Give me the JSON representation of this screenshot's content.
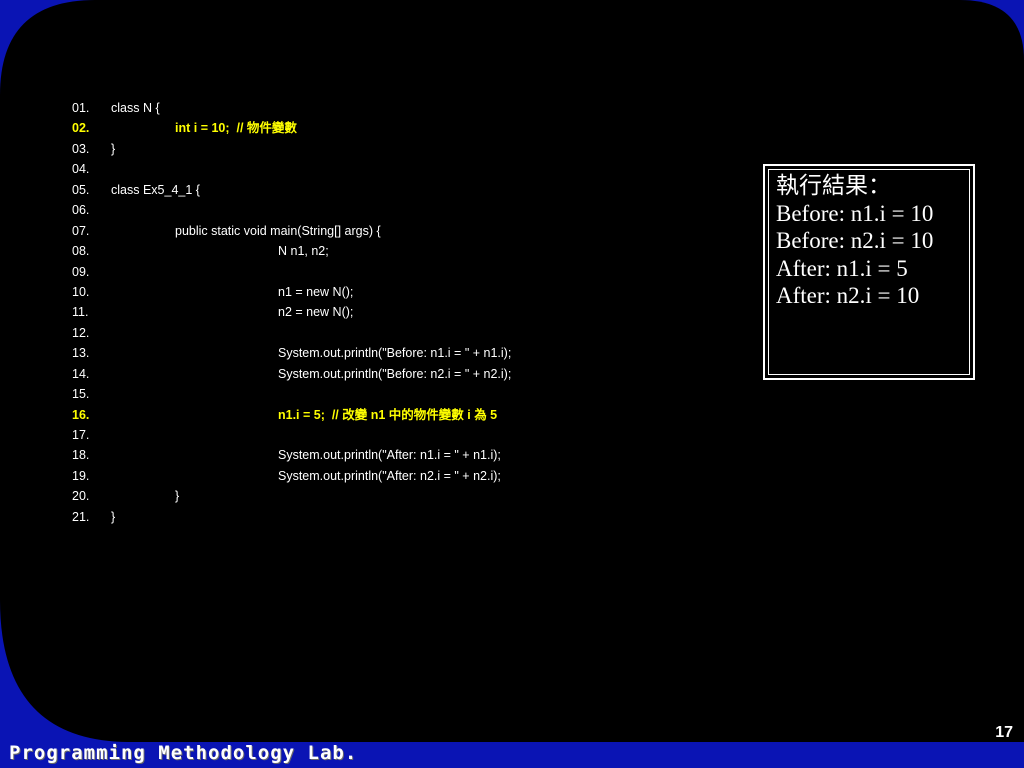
{
  "code": {
    "lines": [
      {
        "num": "01.",
        "indent": 0,
        "text": "class N {",
        "highlight": false
      },
      {
        "num": "02.",
        "indent": 1,
        "text": "int i = 10;  // 物件變數",
        "highlight": true
      },
      {
        "num": "03.",
        "indent": 0,
        "text": "}",
        "highlight": false
      },
      {
        "num": "04.",
        "indent": 0,
        "text": "",
        "highlight": false
      },
      {
        "num": "05.",
        "indent": 0,
        "text": "class Ex5_4_1 {",
        "highlight": false
      },
      {
        "num": "06.",
        "indent": 0,
        "text": "",
        "highlight": false
      },
      {
        "num": "07.",
        "indent": 1,
        "text": "public static void main(String[] args) {",
        "highlight": false
      },
      {
        "num": "08.",
        "indent": 2,
        "text": "N n1, n2;",
        "highlight": false
      },
      {
        "num": "09.",
        "indent": 0,
        "text": "",
        "highlight": false
      },
      {
        "num": "10.",
        "indent": 2,
        "text": "n1 = new N();",
        "highlight": false
      },
      {
        "num": "11.",
        "indent": 2,
        "text": "n2 = new N();",
        "highlight": false
      },
      {
        "num": "12.",
        "indent": 0,
        "text": "",
        "highlight": false
      },
      {
        "num": "13.",
        "indent": 2,
        "text": "System.out.println(\"Before: n1.i = \" + n1.i);",
        "highlight": false
      },
      {
        "num": "14.",
        "indent": 2,
        "text": "System.out.println(\"Before: n2.i = \" + n2.i);",
        "highlight": false
      },
      {
        "num": "15.",
        "indent": 0,
        "text": "",
        "highlight": false
      },
      {
        "num": "16.",
        "indent": 2,
        "text": "n1.i = 5;  // 改變 n1 中的物件變數 i 為 5",
        "highlight": true
      },
      {
        "num": "17.",
        "indent": 0,
        "text": "",
        "highlight": false
      },
      {
        "num": "18.",
        "indent": 2,
        "text": "System.out.println(\"After: n1.i = \" + n1.i);",
        "highlight": false
      },
      {
        "num": "19.",
        "indent": 2,
        "text": "System.out.println(\"After: n2.i = \" + n2.i);",
        "highlight": false
      },
      {
        "num": "20.",
        "indent": 1,
        "text": "}",
        "highlight": false
      },
      {
        "num": "21.",
        "indent": 0,
        "text": "}",
        "highlight": false
      }
    ]
  },
  "output": {
    "title": "執行結果：",
    "lines": [
      "Before: n1.i = 10",
      "Before: n2.i = 10",
      "After: n1.i = 5",
      "After: n2.i = 10"
    ]
  },
  "footer": {
    "lab_name": "Programming Methodology Lab.",
    "page_number": "17"
  },
  "colors": {
    "background": "#000000",
    "frame_blue": "#0a14b4",
    "text": "#ffffff",
    "highlight": "#ffff00"
  }
}
